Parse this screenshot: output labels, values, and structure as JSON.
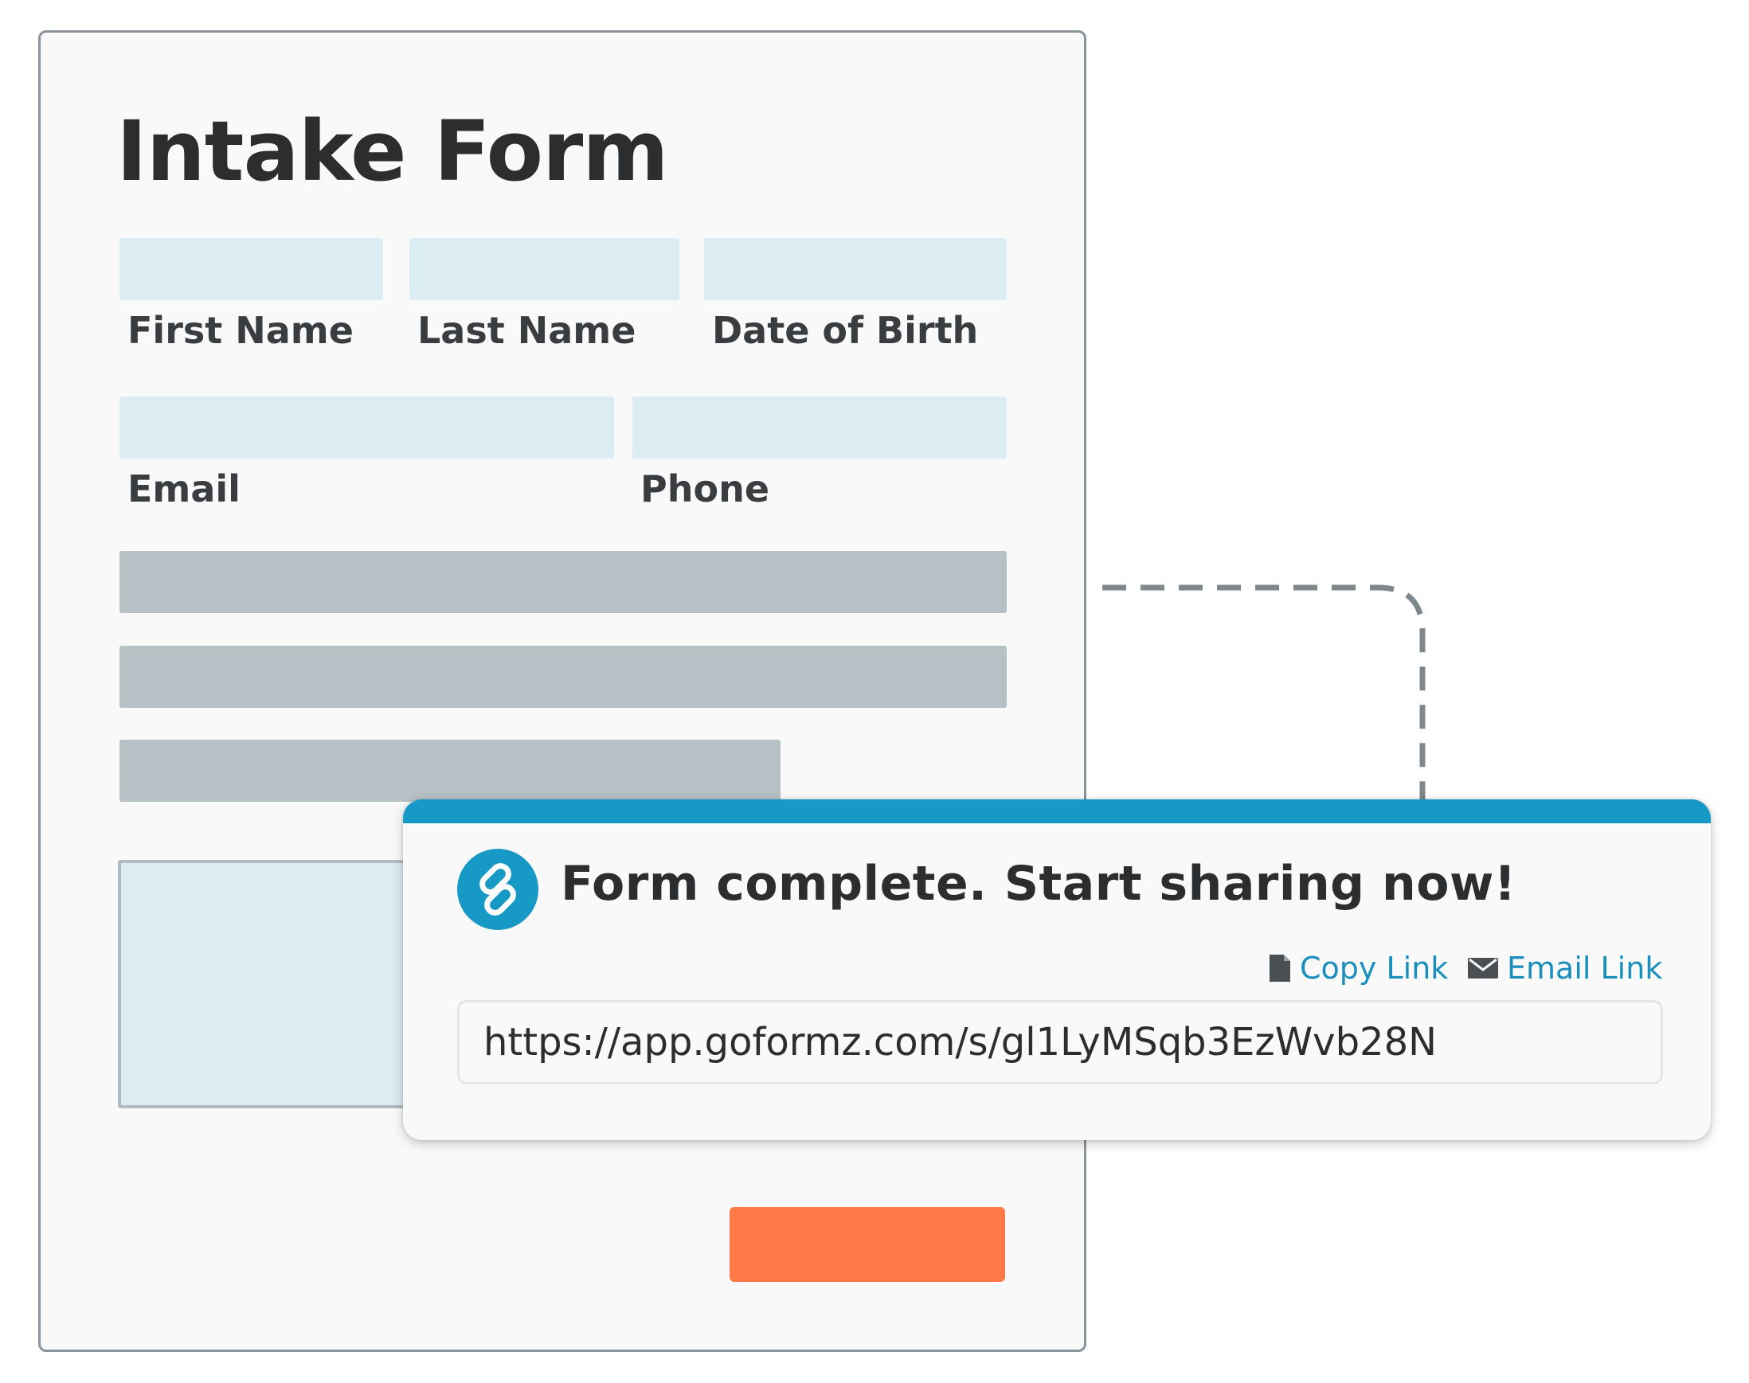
{
  "form": {
    "title": "Intake Form",
    "fields": {
      "first_name_label": "First Name",
      "last_name_label": "Last Name",
      "date_of_birth_label": "Date of Birth",
      "email_label": "Email",
      "phone_label": "Phone"
    }
  },
  "share_panel": {
    "title": "Form complete. Start sharing now!",
    "copy_link_label": "Copy Link",
    "email_link_label": "Email Link",
    "url": "https://app.goformz.com/s/gl1LyMSqb3EzWvb28N",
    "icons": {
      "header": "link-icon",
      "copy": "document-icon",
      "email": "envelope-icon"
    }
  },
  "colors": {
    "accent": "#1699c4",
    "submit": "#ff7a46",
    "field_fill": "#dcecf3",
    "placeholder_bar": "#b6c1c5",
    "title_text": "#2b2d2f"
  }
}
